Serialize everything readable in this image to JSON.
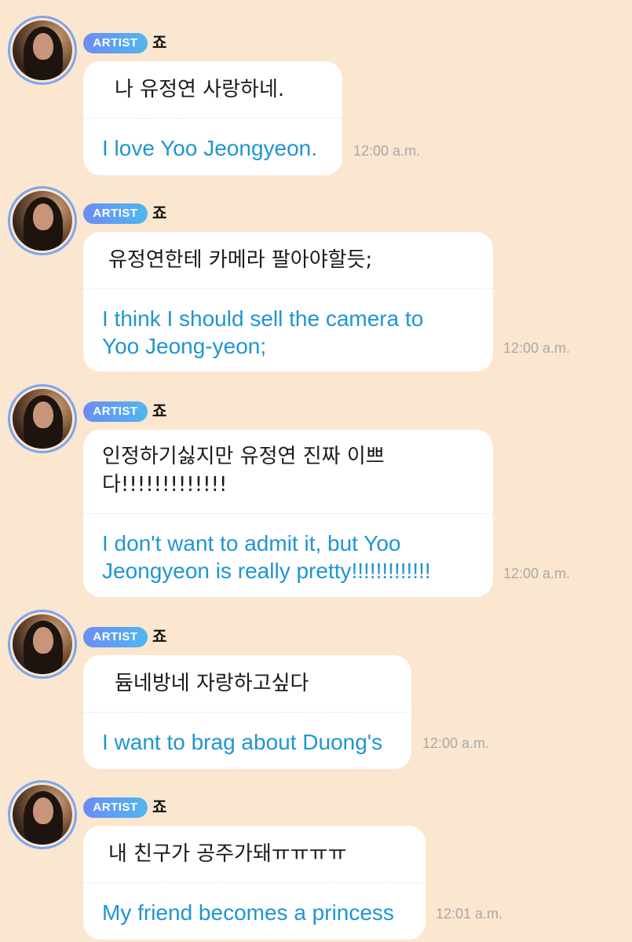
{
  "badge_label": "ARTIST",
  "sender_name": "죠",
  "messages": [
    {
      "korean": [
        "나 유정연 사랑하네."
      ],
      "english": [
        "I love Yoo Jeongyeon."
      ],
      "time": "12:00 a.m."
    },
    {
      "korean": [
        "유정연한테 카메라 팔아야할듯;"
      ],
      "english": [
        "I think I should sell the camera to",
        "Yoo Jeong-yeon;"
      ],
      "time": "12:00 a.m."
    },
    {
      "korean": [
        "인정하기싫지만 유정연 진짜 이쁘",
        "다!!!!!!!!!!!!!"
      ],
      "english": [
        "I don't want to admit it, but Yoo",
        "Jeongyeon is really pretty!!!!!!!!!!!!!"
      ],
      "time": "12:00 a.m."
    },
    {
      "korean": [
        "듐네방네 자랑하고싶다"
      ],
      "english": [
        "I want to brag about Duong's"
      ],
      "time": "12:00 a.m."
    },
    {
      "korean": [
        "내 친구가 공주가돼ㅠㅠㅠㅠ"
      ],
      "english": [
        "My friend becomes a princess"
      ],
      "time": "12:01 a.m."
    }
  ]
}
